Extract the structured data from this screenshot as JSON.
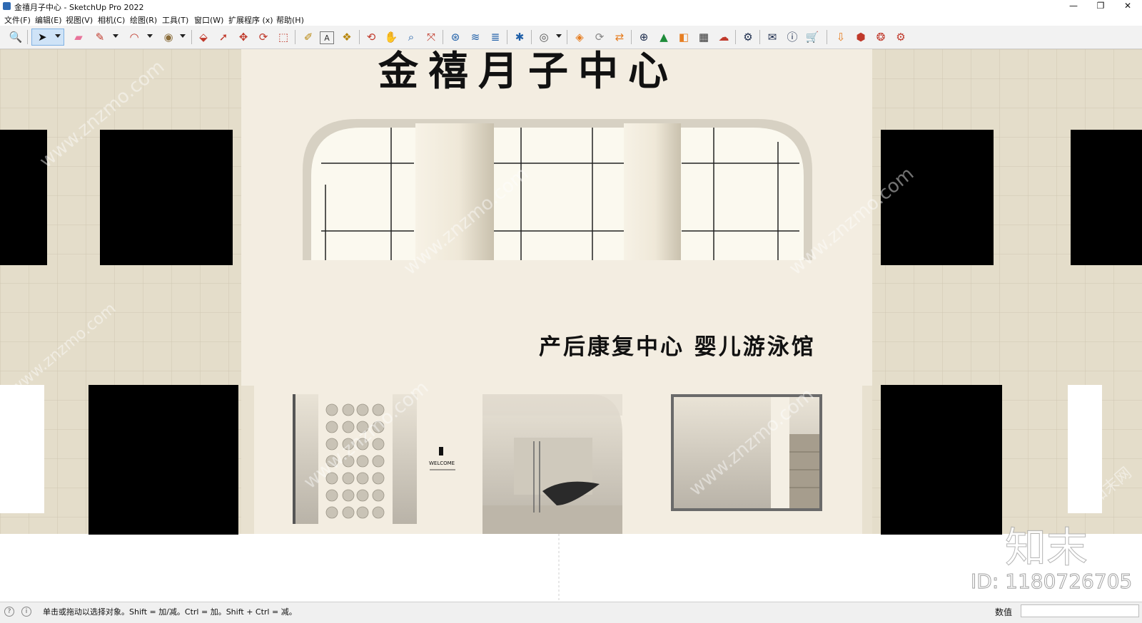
{
  "window": {
    "title": "金禧月子中心 - SketchUp Pro 2022",
    "minimize_glyph": "—",
    "maximize_glyph": "❐",
    "close_glyph": "✕"
  },
  "menubar": {
    "items": [
      {
        "label": "文件(F)"
      },
      {
        "label": "编辑(E)"
      },
      {
        "label": "视图(V)"
      },
      {
        "label": "相机(C)"
      },
      {
        "label": "绘图(R)"
      },
      {
        "label": "工具(T)"
      },
      {
        "label": "窗口(W)"
      },
      {
        "label": "扩展程序 (x)"
      },
      {
        "label": "帮助(H)"
      }
    ]
  },
  "toolbar": {
    "tools": [
      {
        "icon": "zoom-icon",
        "glyph": "🔍",
        "color": "#333333"
      },
      {
        "icon": "select-icon",
        "glyph": "➤",
        "color": "#111111"
      },
      {
        "icon": "eraser-icon",
        "glyph": "▰",
        "color": "#e8739a"
      },
      {
        "icon": "pencil-icon",
        "glyph": "✎",
        "color": "#c0392b"
      },
      {
        "icon": "arc-icon",
        "glyph": "◠",
        "color": "#c0392b"
      },
      {
        "icon": "paint-bucket-icon",
        "glyph": "◉",
        "color": "#8a6d3b"
      },
      {
        "icon": "push-pull-icon",
        "glyph": "⬙",
        "color": "#c0392b"
      },
      {
        "icon": "follow-me-icon",
        "glyph": "➚",
        "color": "#c0392b"
      },
      {
        "icon": "move-icon",
        "glyph": "✥",
        "color": "#c0392b"
      },
      {
        "icon": "rotate-icon",
        "glyph": "⟳",
        "color": "#c0392b"
      },
      {
        "icon": "scale-icon",
        "glyph": "⬚",
        "color": "#c0392b"
      },
      {
        "icon": "tape-measure-icon",
        "glyph": "✐",
        "color": "#b8860b"
      },
      {
        "icon": "text-icon",
        "glyph": "A",
        "color": "#333333"
      },
      {
        "icon": "paint-icon",
        "glyph": "❖",
        "color": "#b8860b"
      },
      {
        "icon": "orbit-icon",
        "glyph": "⟲",
        "color": "#c0392b"
      },
      {
        "icon": "pan-icon",
        "glyph": "✋",
        "color": "#b8860b"
      },
      {
        "icon": "zoom-tool-icon",
        "glyph": "⌕",
        "color": "#1f5fa8"
      },
      {
        "icon": "zoom-extents-icon",
        "glyph": "⤧",
        "color": "#c0392b"
      },
      {
        "icon": "warehouse-icon",
        "glyph": "⊛",
        "color": "#1f5fa8"
      },
      {
        "icon": "extension-icon",
        "glyph": "≋",
        "color": "#1f5fa8"
      },
      {
        "icon": "layers-icon",
        "glyph": "≣",
        "color": "#1f5fa8"
      },
      {
        "icon": "sandbox-icon",
        "glyph": "✱",
        "color": "#1f5fa8"
      },
      {
        "icon": "user-icon",
        "glyph": "◎",
        "color": "#555555"
      },
      {
        "icon": "plugin-tag-icon",
        "glyph": "◈",
        "color": "#e67e22"
      },
      {
        "icon": "refresh-icon",
        "glyph": "⟳",
        "color": "#888888"
      },
      {
        "icon": "swap-icon",
        "glyph": "⇄",
        "color": "#e67e22"
      },
      {
        "icon": "add-circle-icon",
        "glyph": "⊕",
        "color": "#1a2a4a"
      },
      {
        "icon": "tree-icon",
        "glyph": "▲",
        "color": "#1e8c3a"
      },
      {
        "icon": "stripes-icon",
        "glyph": "◧",
        "color": "#e67e22"
      },
      {
        "icon": "checker-icon",
        "glyph": "▦",
        "color": "#333333"
      },
      {
        "icon": "cloud-upload-icon",
        "glyph": "☁",
        "color": "#c0392b"
      },
      {
        "icon": "gears-icon",
        "glyph": "⚙",
        "color": "#1a2a4a"
      },
      {
        "icon": "mail-icon",
        "glyph": "✉",
        "color": "#1a2a4a"
      },
      {
        "icon": "info-icon",
        "glyph": "ⓘ",
        "color": "#1a2a4a"
      },
      {
        "icon": "cart-icon",
        "glyph": "🛒",
        "color": "#1a2a4a"
      },
      {
        "icon": "import-icon",
        "glyph": "⇩",
        "color": "#e67e22"
      },
      {
        "icon": "box-icon",
        "glyph": "⬢",
        "color": "#c0392b"
      },
      {
        "icon": "fire-icon",
        "glyph": "❂",
        "color": "#c0392b"
      },
      {
        "icon": "settings-icon",
        "glyph": "⚙",
        "color": "#c0392b"
      }
    ]
  },
  "scene": {
    "sign_title": "金禧月子中心",
    "sign_subtitle": "产后康复中心 婴儿游泳馆",
    "welcome_label": "WELCOME",
    "colors": {
      "facade": "#f3ede1",
      "side_wall": "#e4ddca",
      "tile_line": "#cfc7b2",
      "window": "#000000",
      "sign_text": "#111111"
    }
  },
  "watermarks": {
    "site": "www.znzmo.com",
    "cn": "知末网",
    "logo": "知末",
    "id": "ID: 1180726705"
  },
  "statusbar": {
    "message": "单击或拖动以选择对象。Shift = 加/减。Ctrl = 加。Shift + Ctrl = 减。",
    "measure_label": "数值",
    "measure_value": ""
  }
}
